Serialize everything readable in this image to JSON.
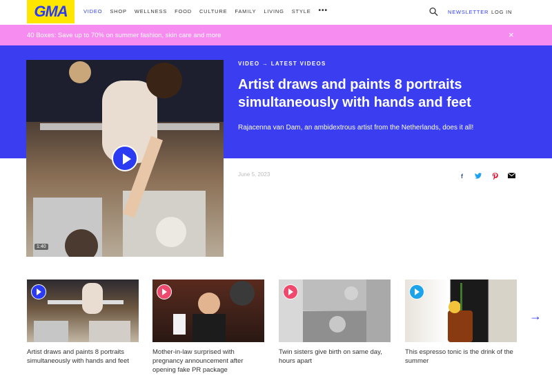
{
  "header": {
    "logo": "GMA",
    "nav": [
      "VIDEO",
      "SHOP",
      "WELLNESS",
      "FOOD",
      "CULTURE",
      "FAMILY",
      "LIVING",
      "STYLE"
    ],
    "more": "•••",
    "newsletter": "NEWSLETTER",
    "login": "LOG IN"
  },
  "promo": {
    "text": "40 Boxes: Save up to 70% on summer fashion, skin care and more",
    "close": "×"
  },
  "hero": {
    "kicker": "VIDEO → LATEST VIDEOS",
    "title": "Artist draws and paints 8 portraits simultaneously with hands and feet",
    "description": "Rajacenna van Dam, an ambidextrous artist from the Netherlands, does it all!",
    "date": "June 5, 2023",
    "duration": "1:40",
    "share": {
      "facebook": "f",
      "twitter": "🐦",
      "pinterest": "℗",
      "mail": "✉"
    }
  },
  "cards": [
    {
      "title": "Artist draws and paints 8 portraits simultaneously with hands and feet",
      "play_color": "#2b3bf2"
    },
    {
      "title": "Mother-in-law surprised with pregnancy announcement after opening fake PR package",
      "play_color": "#ef4a6e"
    },
    {
      "title": "Twin sisters give birth on same day, hours apart",
      "play_color": "#ef4a6e"
    },
    {
      "title": "This espresso tonic is the drink of the summer",
      "play_color": "#1ca3ec"
    }
  ],
  "next": "→",
  "colors": {
    "brand_blue": "#2b3bf2",
    "promo_pink": "#f78cf0",
    "logo_yellow": "#ffe600",
    "hero_blue": "#3a3ef0"
  }
}
